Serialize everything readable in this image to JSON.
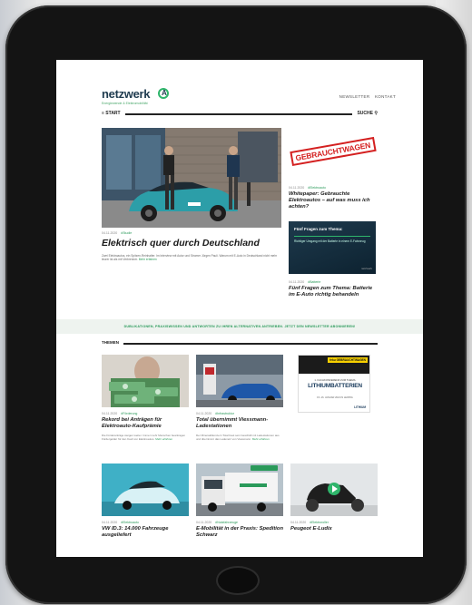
{
  "site": {
    "logo": "netzwerk",
    "logo_mark": "A",
    "logo_sub": "Energiewende & Elektromobilität",
    "nav_links": [
      "NEWSLETTER",
      "KONTAKT"
    ],
    "start_label": "≡ START",
    "search_label": "SUCHE ⚲"
  },
  "hero": {
    "meta_date": "04.11.2020",
    "meta_tag": "#Studie",
    "title": "Elektrisch quer durch Deutschland",
    "text": "Zwei Elektroautos, ein Spitzen-Reinhalter. Im Interview mit Autor und Stromer Jürgen Pauli. Warum mit E-Auto in Deutschland nicht mehr teurer ist als mit Verbrenner.",
    "read_more": "Mehr erfahren"
  },
  "side": {
    "stamp": "GEBRAUCHTWAGEN",
    "item1_date": "04.11.2020",
    "item1_tag": "#Elektroauto",
    "item1_title": "Whitepaper: Gebrauchte Elektroautos – auf was muss ich achten?",
    "video_title": "Fünf Fragen zum Thema:",
    "video_sub": "Richtiger Umgang mit der Batterie in einem E-Fahrzeug",
    "video_brand": "netzwerk",
    "item2_date": "04.11.2020",
    "item2_tag": "#Batterie",
    "item2_title": "Fünf Fragen zum Thema: Batterie im E-Auto richtig behandeln"
  },
  "banner": "DUBLIKATIONEN, PRAXISWISSEN UND ANTWORTEN ZU IHREN ALTERNATIVEN ANTRIEBEN. JETZT DEN NEWSLETTER ABONNIEREN!",
  "themen_label": "THEMEN",
  "cards": [
    {
      "date": "04.11.2020",
      "tag": "#Förderung",
      "title": "Rekord bei Anträgen für Elektroauto-Kaufprämie",
      "text": "Die Förderanträge steigen weiter. Immer mehr Menschen beantragen Fördergelder für den Kauf von Elektroautos.",
      "more": "Mehr erfahren"
    },
    {
      "date": "04.11.2020",
      "tag": "#Infrastruktur",
      "title": "Total übernimmt Viessmann-Ladestationen",
      "text": "Der Mineralölkonzern Total baut sein Geschäft mit Ladestationen aus und übernimmt das Ladenetz von Viessmann.",
      "more": "Mehr erfahren"
    },
    {
      "date": "04.11.2020",
      "tag": "#Elektroauto",
      "title": "VW ID.3: 14.000 Fahrzeuge ausgeliefert",
      "text": "",
      "more": ""
    },
    {
      "date": "04.11.2020",
      "tag": "#Nutzfahrzeuge",
      "title": "E-Mobilität in der Praxis: Spedition Schwarz",
      "text": "",
      "more": ""
    },
    {
      "date": "04.11.2020",
      "tag": "#Elektroroller",
      "title": "Peugeot E-Ludix",
      "text": "",
      "more": ""
    }
  ],
  "ad": {
    "badge": "feku GEBRAUCHTWAGEN",
    "line1": "1. FACHKONFERENZ ZUM THEMA",
    "line2": "LITHIUMBATTERIEN",
    "line3": "15.-16. JANUAR 2021 IN LEIPZIG",
    "logo": "LITHIUM"
  },
  "colors": {
    "accent": "#2a9a5a",
    "stamp": "#d42020",
    "frame": "#141414"
  }
}
